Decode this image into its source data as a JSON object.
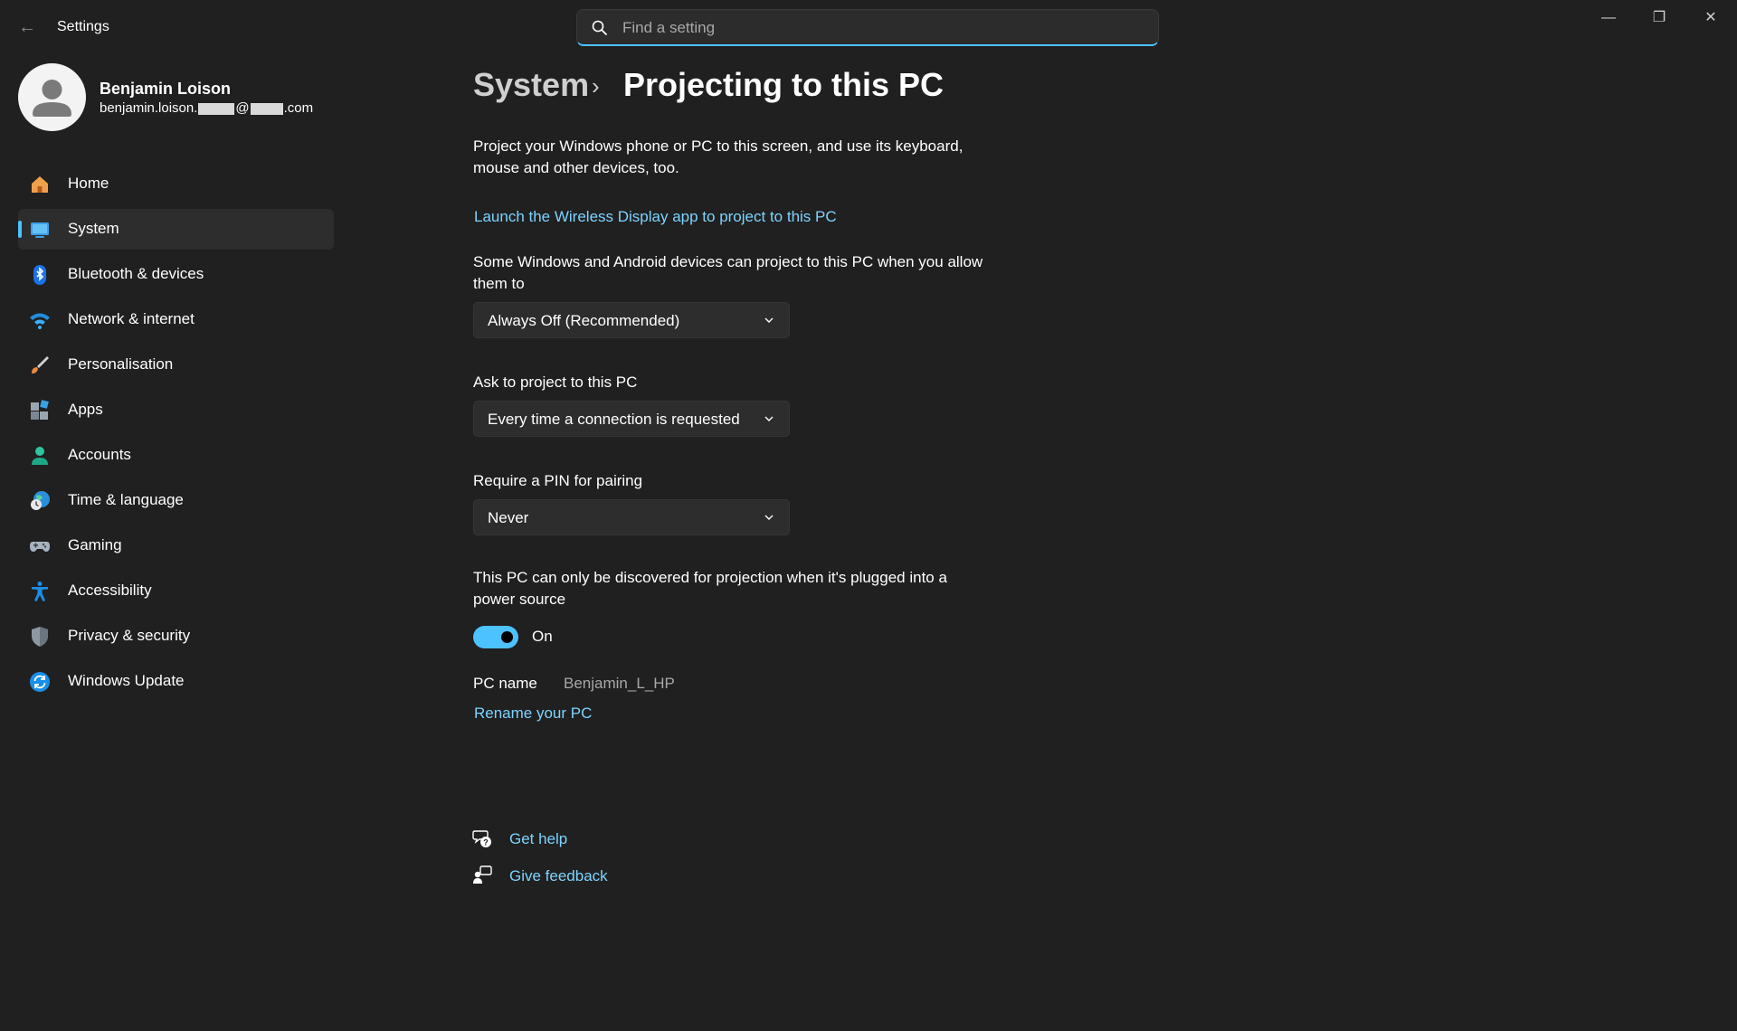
{
  "window": {
    "title": "Settings",
    "back_icon": "←",
    "minimize_icon": "—",
    "maximize_icon": "❐",
    "close_icon": "✕"
  },
  "search": {
    "placeholder": "Find a setting",
    "value": ""
  },
  "profile": {
    "name": "Benjamin Loison",
    "email_prefix": "benjamin.loison.",
    "email_at": "@",
    "email_suffix": ".com"
  },
  "sidebar": {
    "items": [
      {
        "label": "Home",
        "icon": "home-icon"
      },
      {
        "label": "System",
        "icon": "system-icon",
        "selected": true
      },
      {
        "label": "Bluetooth & devices",
        "icon": "bluetooth-icon"
      },
      {
        "label": "Network & internet",
        "icon": "wifi-icon"
      },
      {
        "label": "Personalisation",
        "icon": "brush-icon"
      },
      {
        "label": "Apps",
        "icon": "apps-icon"
      },
      {
        "label": "Accounts",
        "icon": "account-icon"
      },
      {
        "label": "Time & language",
        "icon": "globe-clock-icon"
      },
      {
        "label": "Gaming",
        "icon": "gamepad-icon"
      },
      {
        "label": "Accessibility",
        "icon": "accessibility-icon"
      },
      {
        "label": "Privacy & security",
        "icon": "shield-icon"
      },
      {
        "label": "Windows Update",
        "icon": "update-icon"
      }
    ]
  },
  "breadcrumb": {
    "parent": "System",
    "separator": "›",
    "current": "Projecting to this PC"
  },
  "main": {
    "intro": "Project your Windows phone or PC to this screen, and use its keyboard, mouse and other devices, too.",
    "launch_link": "Launch the Wireless Display app to project to this PC",
    "allow_label": "Some Windows and Android devices can project to this PC when you allow them to",
    "allow_value": "Always Off (Recommended)",
    "ask_label": "Ask to project to this PC",
    "ask_value": "Every time a connection is requested",
    "pin_label": "Require a PIN for pairing",
    "pin_value": "Never",
    "power_label": "This PC can only be discovered for projection when it's plugged into a power source",
    "power_toggle_state": "On",
    "pc_name_label": "PC name",
    "pc_name_value": "Benjamin_L_HP",
    "rename_link": "Rename your PC"
  },
  "help": {
    "get_help": "Get help",
    "give_feedback": "Give feedback"
  },
  "colors": {
    "accent": "#4cc2ff",
    "link": "#7ed3ff",
    "background": "#202020"
  }
}
